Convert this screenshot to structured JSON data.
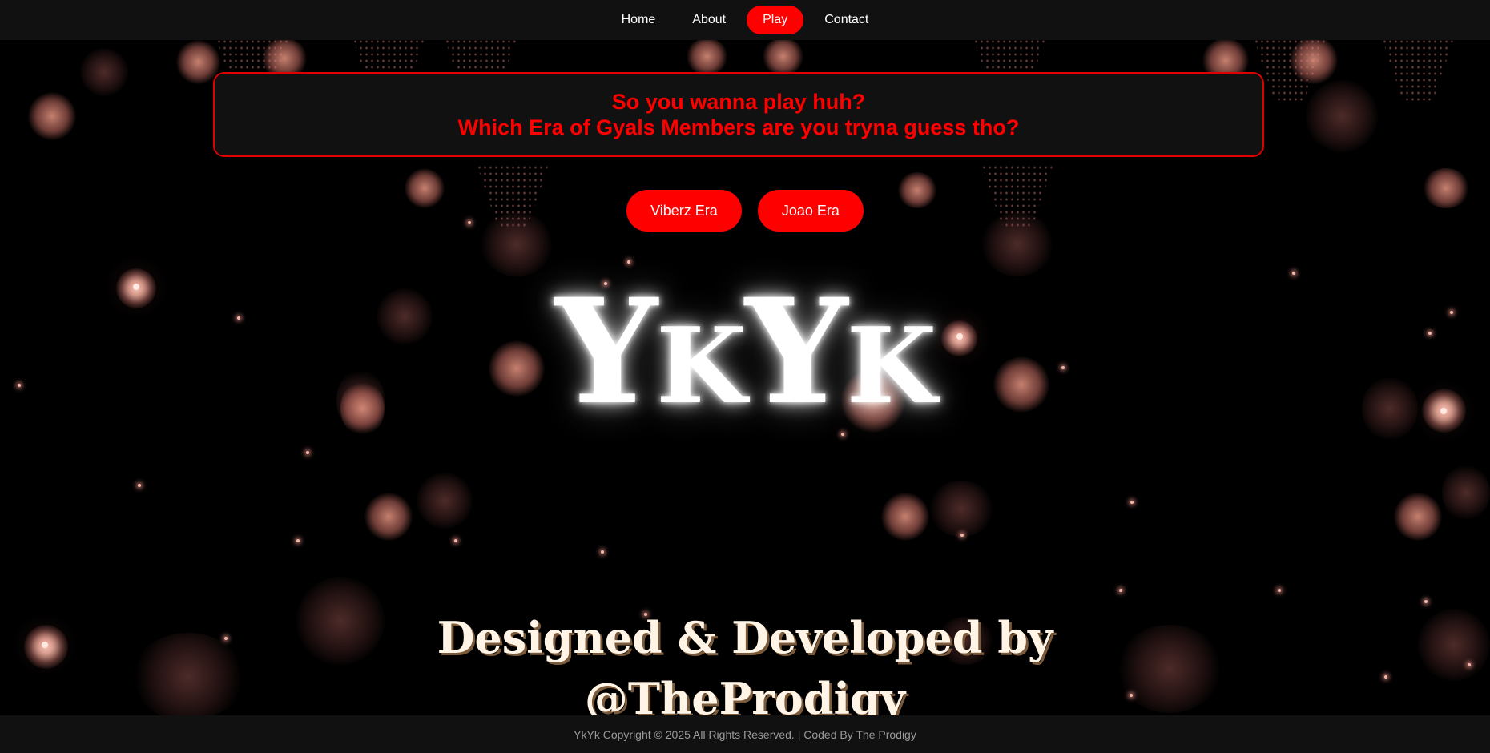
{
  "nav": {
    "items": [
      {
        "label": "Home",
        "active": false
      },
      {
        "label": "About",
        "active": false
      },
      {
        "label": "Play",
        "active": true
      },
      {
        "label": "Contact",
        "active": false
      }
    ]
  },
  "prompt": {
    "line1": "So you wanna play huh?",
    "line2": "Which Era of Gyals Members are you tryna guess tho?"
  },
  "eras": {
    "viberz_label": "Viberz Era",
    "joao_label": "Joao Era"
  },
  "logo": {
    "part1": "Y",
    "part2": "K",
    "part3": "Y",
    "part4": "K"
  },
  "credit": {
    "line1": "Designed & Developed by",
    "line2": "@TheProdigy"
  },
  "footer": {
    "text": "YkYk Copyright © 2025 All Rights Reserved. | Coded By The Prodigy"
  },
  "colors": {
    "accent": "#ff0000",
    "bar_background": "#111111",
    "page_background": "#000000"
  }
}
